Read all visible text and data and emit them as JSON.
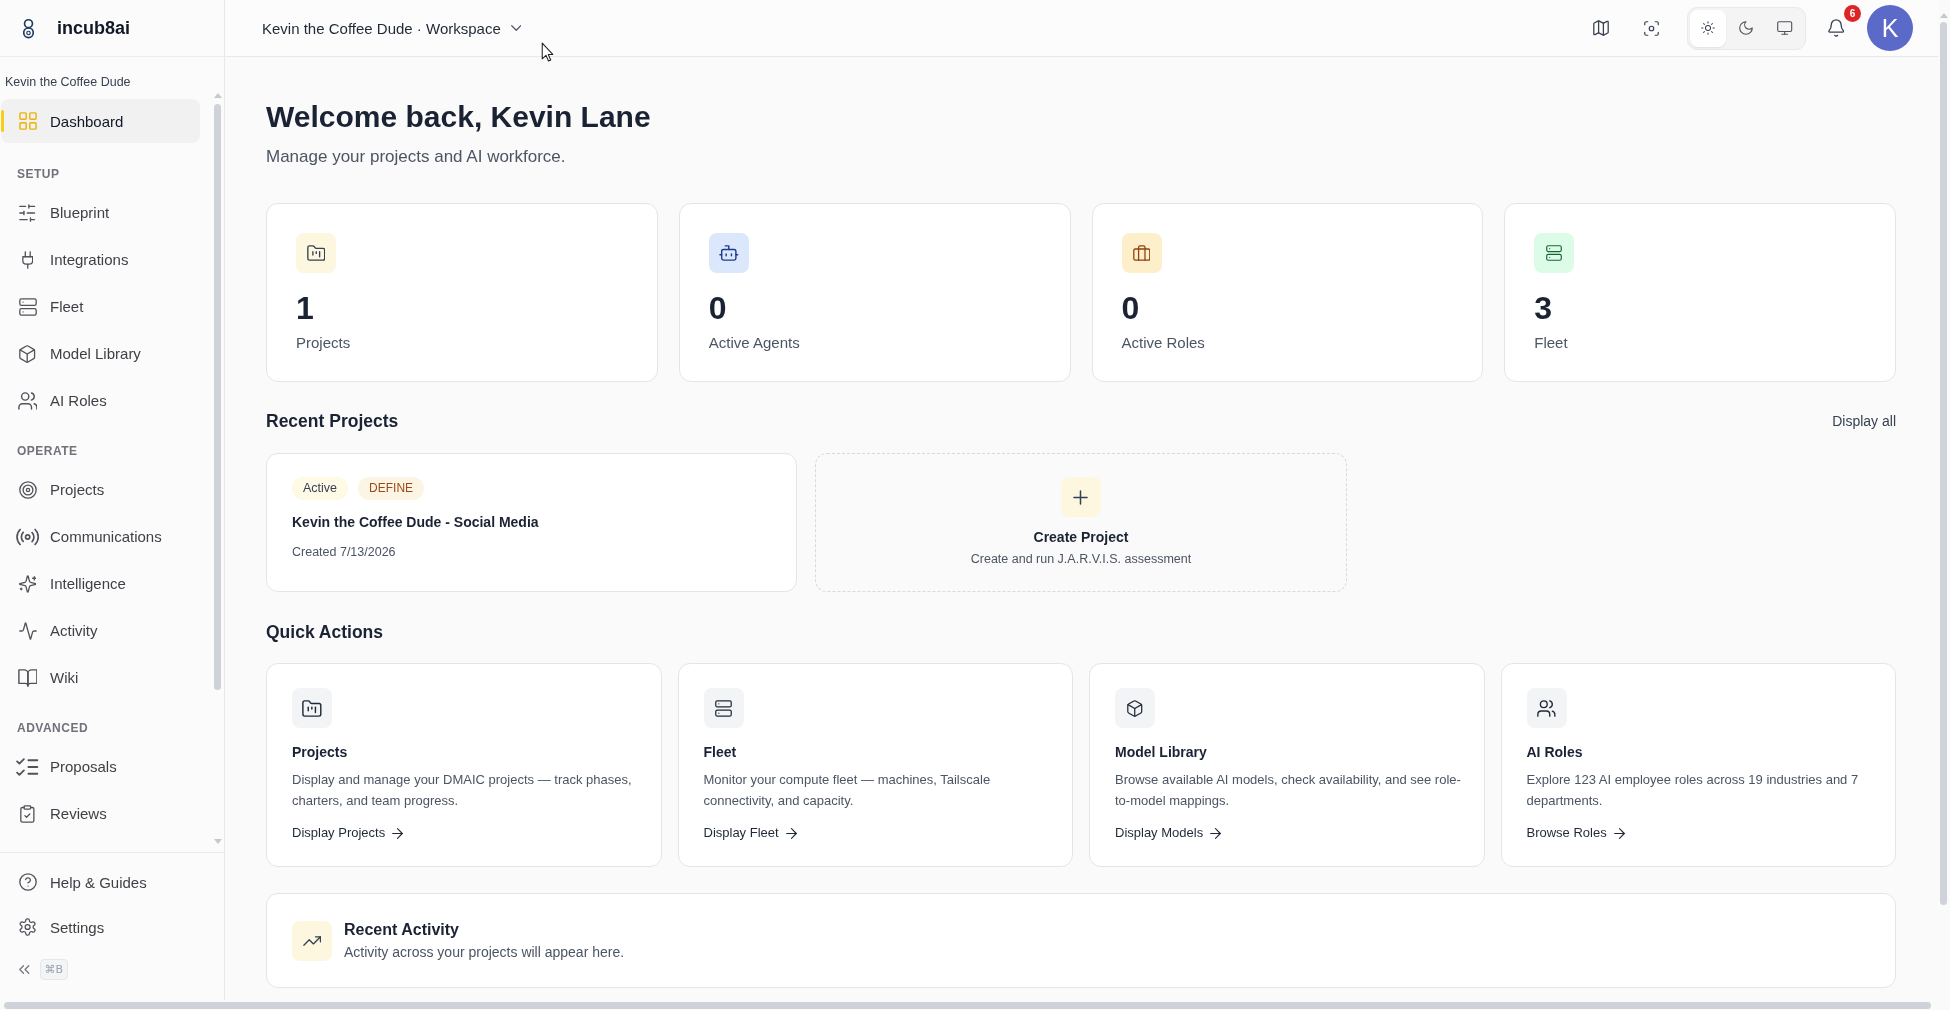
{
  "sidebar": {
    "logo": "incub8ai",
    "workspace": "Kevin the Coffee Dude",
    "home": {
      "label": "Dashboard",
      "selected": true
    },
    "sections": [
      {
        "heading": "SETUP",
        "items": [
          {
            "label": "Blueprint",
            "selected": false
          },
          {
            "label": "Integrations",
            "selected": false
          },
          {
            "label": "Fleet",
            "selected": false
          },
          {
            "label": "Model Library",
            "selected": false
          },
          {
            "label": "AI Roles",
            "selected": false
          }
        ]
      },
      {
        "heading": "OPERATE",
        "items": [
          {
            "label": "Projects",
            "selected": false
          },
          {
            "label": "Communications",
            "selected": false
          },
          {
            "label": "Intelligence",
            "selected": false
          },
          {
            "label": "Activity",
            "selected": false
          },
          {
            "label": "Wiki",
            "selected": false
          }
        ]
      },
      {
        "heading": "ADVANCED",
        "items": [
          {
            "label": "Proposals",
            "selected": false
          },
          {
            "label": "Reviews",
            "selected": false
          }
        ]
      }
    ],
    "footer_items": [
      {
        "label": "Help & Guides",
        "selected": false
      },
      {
        "label": "Settings",
        "selected": false
      }
    ],
    "shortcut": "⌘B"
  },
  "top_bar": {
    "workspace_switcher": "Kevin the Coffee Dude · Workspace",
    "theme_options": [
      {
        "selected": true
      },
      {
        "selected": false
      },
      {
        "selected": false
      }
    ],
    "notifications_badge": "6",
    "avatar_initial": "K"
  },
  "page": {
    "title": "Welcome back, Kevin Lane",
    "subtitle": "Manage your projects and AI workforce."
  },
  "stats": [
    {
      "value": "1",
      "label": "Projects"
    },
    {
      "value": "0",
      "label": "Active Agents"
    },
    {
      "value": "0",
      "label": "Active Roles"
    },
    {
      "value": "3",
      "label": "Fleet"
    }
  ],
  "recent_projects": {
    "heading": "Recent Projects",
    "link": "Display all",
    "projects": [
      {
        "tags": [
          {
            "text": "Active",
            "kind": "status"
          },
          {
            "text": "DEFINE",
            "kind": "phase"
          }
        ],
        "title": "Kevin the Coffee Dude - Social Media",
        "created": "Created 7/13/2026"
      }
    ],
    "create_card": {
      "title": "Create Project",
      "subtitle": "Create and run J.A.R.V.I.S. assessment"
    }
  },
  "quick_actions": {
    "heading": "Quick Actions",
    "cards": [
      {
        "title": "Projects",
        "description": "Display and manage your DMAIC projects — track phases, charters, and team progress.",
        "link": "Display Projects"
      },
      {
        "title": "Fleet",
        "description": "Monitor your compute fleet — machines, Tailscale connectivity, and capacity.",
        "link": "Display Fleet"
      },
      {
        "title": "Model Library",
        "description": "Browse available AI models, check availability, and see role-to-model mappings.",
        "link": "Display Models"
      },
      {
        "title": "AI Roles",
        "description": "Explore 123 AI employee roles across 19 industries and 7 departments.",
        "link": "Browse Roles"
      }
    ]
  },
  "recent_activity": {
    "title": "Recent Activity",
    "subtitle": "Activity across your projects will appear here."
  }
}
